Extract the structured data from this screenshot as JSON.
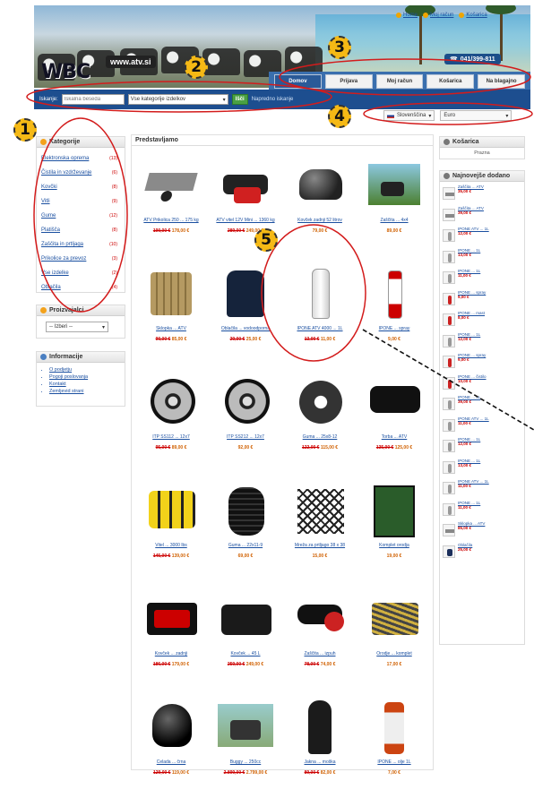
{
  "header": {
    "brand": "WBC",
    "site_url": "www.atv.si",
    "top_links": [
      "Home",
      "Moj račun",
      "Košarica"
    ],
    "phone": "041/399-811"
  },
  "nav": {
    "tabs": [
      "Domov",
      "Prijava",
      "Moj račun",
      "Košarica",
      "Na blagajno"
    ]
  },
  "search": {
    "label": "Iskanje:",
    "placeholder": "Iskalna beseda",
    "category": "Vse kategorije izdelkov",
    "button": "Išči",
    "advanced": "Napredno iskanje"
  },
  "selectors": {
    "language": "Slovenščina",
    "currency": "Euro"
  },
  "categories": {
    "title": "Kategorije",
    "items": [
      {
        "label": "Elektronska oprema",
        "count": "(13)"
      },
      {
        "label": "Čistila in vzdrževanje",
        "count": "(6)"
      },
      {
        "label": "Kovčki",
        "count": "(8)"
      },
      {
        "label": "Vitli",
        "count": "(9)"
      },
      {
        "label": "Gume",
        "count": "(12)"
      },
      {
        "label": "Platišča",
        "count": "(8)"
      },
      {
        "label": "Zaščita in prtljaga",
        "count": "(10)"
      },
      {
        "label": "Prikolice za prevoz",
        "count": "(3)"
      },
      {
        "label": "Vse izdelke",
        "count": "(2)"
      },
      {
        "label": "Oblačila",
        "count": "(4)"
      }
    ]
  },
  "manufacturers": {
    "title": "Proizvajalci",
    "select": "-- Izberi --"
  },
  "information": {
    "title": "Informacije",
    "links": [
      "O podjetju",
      "Pogoji poslovanja",
      "Kontakt",
      "Zemljevid strani"
    ]
  },
  "products": {
    "title": "Predstavljamo",
    "items": [
      {
        "name": "ATV Prikolica 250 ... 175 kg",
        "sub": "",
        "old": "190,00 €",
        "new": "178,00 €",
        "shape": "trailer"
      },
      {
        "name": "ATV vitel 12V Mini ... 1360 kg",
        "sub": "",
        "old": "289,00 €",
        "new": "249,00 €",
        "shape": "tool"
      },
      {
        "name": "Kovček zadnji 52 litrov",
        "sub": "",
        "old": "",
        "new": "79,00 €",
        "shape": "case"
      },
      {
        "name": "Zaščita ... 4x4",
        "sub": "",
        "old": "",
        "new": "89,00 €",
        "shape": "photo"
      },
      {
        "name": "Sklopka ... ATV",
        "sub": "",
        "old": "90,00 €",
        "new": "85,00 €",
        "shape": "clutch"
      },
      {
        "name": "Oblačila ... vodoodporna",
        "sub": "",
        "old": "29,00 €",
        "new": "25,00 €",
        "shape": "jacket"
      },
      {
        "name": "IPONE ATV 4000 ... 1L",
        "sub": "",
        "old": "13,00 €",
        "new": "11,00 €",
        "shape": "bottle"
      },
      {
        "name": "IPONE ... spray",
        "sub": "",
        "old": "",
        "new": "9,00 €",
        "shape": "spray"
      },
      {
        "name": "ITP SS112 ... 12x7",
        "sub": "",
        "old": "95,00 €",
        "new": "89,00 €",
        "shape": "rim"
      },
      {
        "name": "ITP SS212 ... 12x7",
        "sub": "",
        "old": "",
        "new": "92,00 €",
        "shape": "rim"
      },
      {
        "name": "Guma ... 25x8-12",
        "sub": "",
        "old": "122,00 €",
        "new": "115,00 €",
        "shape": "tyre"
      },
      {
        "name": "Torba ... ATV",
        "sub": "",
        "old": "135,00 €",
        "new": "125,00 €",
        "shape": "bag"
      },
      {
        "name": "Vitel ... 3000 lbs",
        "sub": "",
        "old": "145,00 €",
        "new": "139,00 €",
        "shape": "yellow"
      },
      {
        "name": "Guma ... 22x11-9",
        "sub": "",
        "old": "",
        "new": "69,00 €",
        "shape": "tyre2"
      },
      {
        "name": "Mreža za prtljago 38 x 38",
        "sub": "",
        "old": "",
        "new": "15,00 €",
        "shape": "net"
      },
      {
        "name": "Komplet orodja",
        "sub": "",
        "old": "",
        "new": "19,00 €",
        "shape": "kit"
      },
      {
        "name": "Kovček ... zadnji",
        "sub": "",
        "old": "186,00 €",
        "new": "179,00 €",
        "shape": "case2"
      },
      {
        "name": "Kovček ... 45 L",
        "sub": "",
        "old": "259,00 €",
        "new": "249,00 €",
        "shape": "box"
      },
      {
        "name": "Zaščita ... izpuh",
        "sub": "",
        "old": "78,00 €",
        "new": "74,00 €",
        "shape": "pipe"
      },
      {
        "name": "Orodje ... komplet",
        "sub": "",
        "old": "",
        "new": "17,00 €",
        "shape": "tools"
      },
      {
        "name": "Čelada ... črna",
        "sub": "",
        "old": "129,00 €",
        "new": "119,00 €",
        "shape": "helmet"
      },
      {
        "name": "Buggy ... 250cc",
        "sub": "",
        "old": "2.899,00 €",
        "new": "2.799,00 €",
        "shape": "buggy"
      },
      {
        "name": "Jakna ... moška",
        "sub": "",
        "old": "89,00 €",
        "new": "82,00 €",
        "shape": "rider"
      },
      {
        "name": "IPONE ... olje 1L",
        "sub": "",
        "old": "",
        "new": "7,00 €",
        "shape": "can"
      }
    ]
  },
  "cart": {
    "title": "Košarica",
    "empty": "Prazna"
  },
  "newest": {
    "title": "Najnovejše dodano",
    "items": [
      {
        "name": "Zaščita ... ATV",
        "price": "35,00 €",
        "thumb": "i0"
      },
      {
        "name": "Zaščita ... ATV",
        "price": "39,00 €",
        "thumb": "i0"
      },
      {
        "name": "IPONE ATV ... 1L",
        "price": "12,00 €",
        "thumb": "i1"
      },
      {
        "name": "IPONE ... 1L",
        "price": "13,00 €",
        "thumb": "i1"
      },
      {
        "name": "IPONE ... 1L",
        "price": "11,00 €",
        "thumb": "i1"
      },
      {
        "name": "IPONE ... spray",
        "price": "9,00 €",
        "thumb": "i2"
      },
      {
        "name": "IPONE ... mast",
        "price": "8,00 €",
        "thumb": "i2"
      },
      {
        "name": "IPONE ... 1L",
        "price": "12,00 €",
        "thumb": "i1"
      },
      {
        "name": "IPONE ... spray",
        "price": "9,00 €",
        "thumb": "i2"
      },
      {
        "name": "IPONE ... čistilo",
        "price": "10,00 €",
        "thumb": "i2"
      },
      {
        "name": "IPONE ... 4L",
        "price": "39,00 €",
        "thumb": "i1"
      },
      {
        "name": "IPONE ATV ... 1L",
        "price": "11,00 €",
        "thumb": "i1"
      },
      {
        "name": "IPONE ... 1L",
        "price": "12,00 €",
        "thumb": "i1"
      },
      {
        "name": "IPONE ... 1L",
        "price": "13,00 €",
        "thumb": "i1"
      },
      {
        "name": "IPONE ATV ... 1L",
        "price": "11,00 €",
        "thumb": "i1"
      },
      {
        "name": "IPONE ... 1L",
        "price": "11,00 €",
        "thumb": "i1"
      },
      {
        "name": "Sklopka ... ATV",
        "price": "85,00 €",
        "thumb": "i0"
      },
      {
        "name": "Oblačila",
        "price": "25,00 €",
        "thumb": "i3"
      }
    ]
  },
  "annotations": {
    "badges": [
      "1",
      "2",
      "3",
      "4",
      "5"
    ]
  }
}
